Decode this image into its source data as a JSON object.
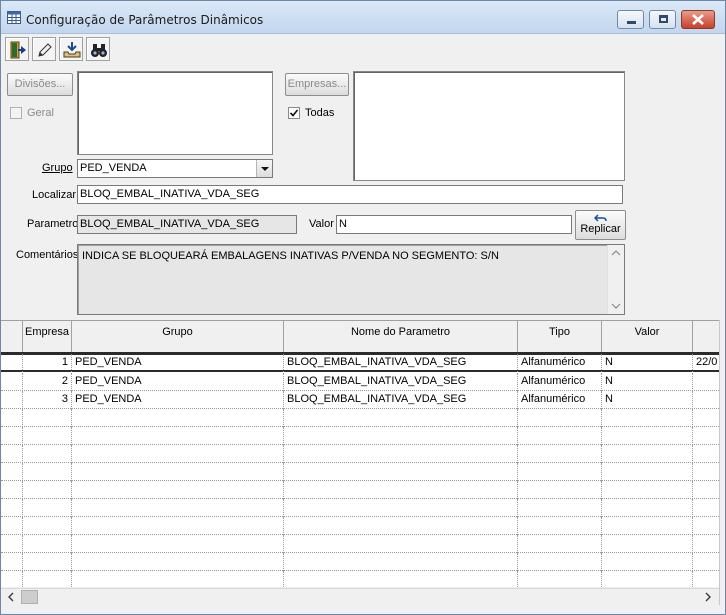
{
  "window": {
    "title": "Configuração de Parâmetros Dinâmicos"
  },
  "toolbar": {
    "icons": [
      "exit-door-icon",
      "edit-pencil-icon",
      "load-tray-icon",
      "binoculars-icon"
    ]
  },
  "form": {
    "divisoes_label": "Divisões...",
    "geral_label": "Geral",
    "empresas_label": "Empresas...",
    "todas_label": "Todas",
    "todas_checked": true,
    "grupo_label": "Grupo",
    "grupo_value": "PED_VENDA",
    "localizar_label": "Localizar",
    "localizar_value": "BLOQ_EMBAL_INATIVA_VDA_SEG",
    "parametro_label": "Parametro",
    "parametro_value": "BLOQ_EMBAL_INATIVA_VDA_SEG",
    "valor_label": "Valor",
    "valor_value": "N",
    "replicar_label": "Replicar",
    "comentarios_label": "Comentários",
    "comentarios_value": "INDICA SE BLOQUEARÁ EMBALAGENS INATIVAS P/VENDA NO SEGMENTO: S/N"
  },
  "grid": {
    "columns": [
      "Empresa",
      "Grupo",
      "Nome do Parametro",
      "Tipo",
      "Valor"
    ],
    "rows": [
      {
        "empresa": "1",
        "grupo": "PED_VENDA",
        "nome": "BLOQ_EMBAL_INATIVA_VDA_SEG",
        "tipo": "Alfanumérico",
        "valor": "N",
        "extra": "22/0"
      },
      {
        "empresa": "2",
        "grupo": "PED_VENDA",
        "nome": "BLOQ_EMBAL_INATIVA_VDA_SEG",
        "tipo": "Alfanumérico",
        "valor": "N",
        "extra": ""
      },
      {
        "empresa": "3",
        "grupo": "PED_VENDA",
        "nome": "BLOQ_EMBAL_INATIVA_VDA_SEG",
        "tipo": "Alfanumérico",
        "valor": "N",
        "extra": ""
      }
    ]
  }
}
